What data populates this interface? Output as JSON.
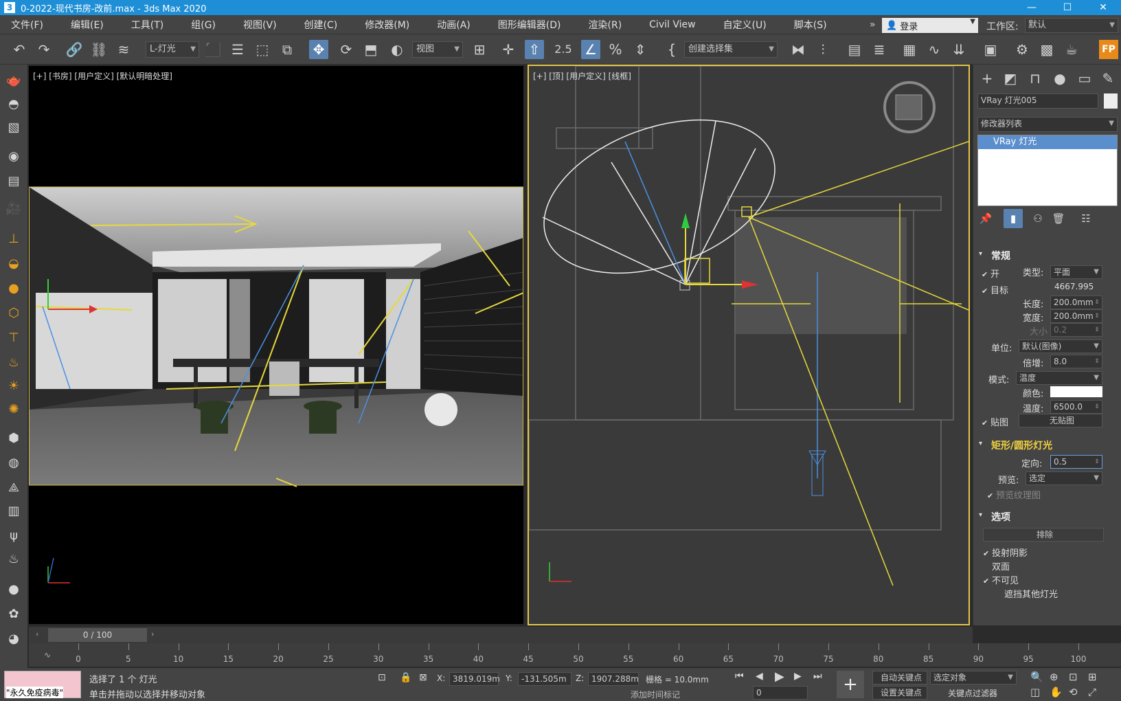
{
  "window": {
    "app_icon": "3",
    "title": "0-2022-现代书房-改前.max - 3ds Max 2020",
    "minimize": "—",
    "maximize": "☐",
    "close": "✕"
  },
  "menu": {
    "items": [
      "文件(F)",
      "编辑(E)",
      "工具(T)",
      "组(G)",
      "视图(V)",
      "创建(C)",
      "修改器(M)",
      "动画(A)",
      "图形编辑器(D)",
      "渲染(R)",
      "Civil View",
      "自定义(U)",
      "脚本(S)"
    ],
    "more": "»",
    "login": "登录",
    "workspace_label": "工作区:",
    "workspace_value": "默认"
  },
  "toolbar": {
    "selection_filter": "L-灯光",
    "ref_coord": "视图",
    "named_selection": "创建选择集",
    "fp_badge": "FP",
    "snap_value": "2.5"
  },
  "viewports": {
    "left_label": "[+] [书房] [用户定义] [默认明暗处理]",
    "right_label": "[+] [顶] [用户定义] [线框]"
  },
  "command_panel": {
    "object_name": "VRay 灯光005",
    "modifier_list": "修改器列表",
    "stack_item": "VRay 灯光",
    "general": {
      "title": "常规",
      "on_label": "开",
      "type_label": "类型:",
      "type_value": "平面",
      "target_label": "目标",
      "target_value": "4667.995",
      "length_label": "长度:",
      "length_value": "200.0mm",
      "width_label": "宽度:",
      "width_value": "200.0mm",
      "size_label": "大小",
      "size_value": "0.2",
      "units_label": "单位:",
      "units_value": "默认(图像)",
      "multiplier_label": "倍增:",
      "multiplier_value": "8.0",
      "mode_label": "模式:",
      "mode_value": "温度",
      "color_label": "颜色:",
      "color_swatch": "#ffffff",
      "temp_label": "温度:",
      "temp_value": "6500.0",
      "map_label": "贴图",
      "map_value": "无贴图"
    },
    "rect_disc": {
      "title": "矩形/圆形灯光",
      "directional_label": "定向:",
      "directional_value": "0.5",
      "preview_label": "预览:",
      "preview_value": "选定",
      "preview_texture": "预览纹理图"
    },
    "options": {
      "title": "选项",
      "exclude_button": "排除",
      "cast_shadows": "投射阴影",
      "double_sided": "双面",
      "invisible": "不可见",
      "occlude_other": "遮挡其他灯光"
    }
  },
  "timeline": {
    "frame_display": "0 / 100",
    "ticks": [
      "0",
      "5",
      "10",
      "15",
      "20",
      "25",
      "30",
      "35",
      "40",
      "45",
      "50",
      "55",
      "60",
      "65",
      "70",
      "75",
      "80",
      "85",
      "90",
      "95",
      "100"
    ]
  },
  "status": {
    "maxscript_text": "\"永久免疫病毒\"",
    "selected": "选择了 1 个 灯光",
    "hint": "单击并拖动以选择并移动对象",
    "x_label": "X:",
    "x_value": "3819.019m",
    "y_label": "Y:",
    "y_value": "-131.505m",
    "z_label": "Z:",
    "z_value": "1907.288m",
    "grid": "栅格 = 10.0mm",
    "add_time_tag": "添加时间标记",
    "auto_key": "自动关键点",
    "selected_object": "选定对象",
    "set_key": "设置关键点",
    "key_filter": "关键点过滤器",
    "frame_field": "0"
  },
  "colors": {
    "accent": "#1e8fd6",
    "viewport_border": "#e5c84a",
    "light_lines": "#e6d93a",
    "fp_badge": "#e88a1a"
  }
}
